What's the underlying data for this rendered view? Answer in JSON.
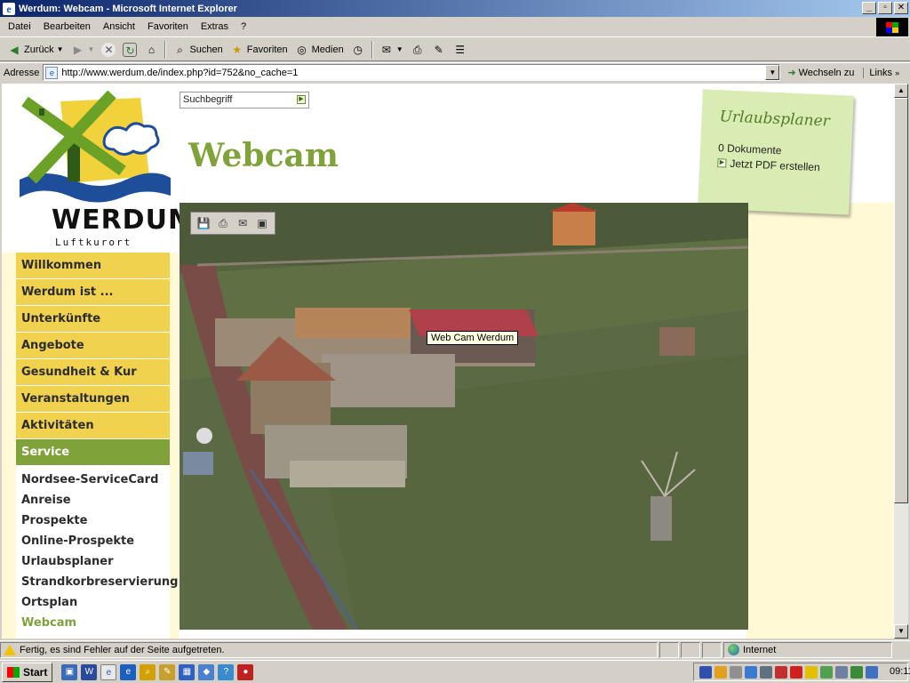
{
  "window": {
    "title": "Werdum: Webcam - Microsoft Internet Explorer",
    "buttons": [
      "_",
      "▫",
      "✕"
    ]
  },
  "menu": [
    "Datei",
    "Bearbeiten",
    "Ansicht",
    "Favoriten",
    "Extras",
    "?"
  ],
  "toolbar": {
    "back": "Zurück",
    "search": "Suchen",
    "favorites": "Favoriten",
    "media": "Medien"
  },
  "address": {
    "label": "Adresse",
    "url": "http://www.werdum.de/index.php?id=752&no_cache=1",
    "go": "Wechseln zu",
    "links": "Links"
  },
  "page": {
    "logo": {
      "name": "WERDUM",
      "sub": "Luftkurort"
    },
    "search_placeholder": "Suchbegriff",
    "title": "Webcam",
    "planner": {
      "title": "Urlaubsplaner",
      "docs": "0 Dokumente",
      "pdf": "Jetzt PDF erstellen"
    },
    "nav": [
      {
        "label": "Willkommen",
        "active": false
      },
      {
        "label": "Werdum ist ...",
        "active": false
      },
      {
        "label": "Unterkünfte",
        "active": false
      },
      {
        "label": "Angebote",
        "active": false
      },
      {
        "label": "Gesundheit & Kur",
        "active": false
      },
      {
        "label": "Veranstaltungen",
        "active": false
      },
      {
        "label": "Aktivitäten",
        "active": false
      },
      {
        "label": "Service",
        "active": true
      }
    ],
    "subnav": [
      {
        "label": "Nordsee-ServiceCard",
        "current": false
      },
      {
        "label": "Anreise",
        "current": false
      },
      {
        "label": "Prospekte",
        "current": false
      },
      {
        "label": "Online-Prospekte",
        "current": false
      },
      {
        "label": "Urlaubsplaner",
        "current": false
      },
      {
        "label": "Strandkorbreservierung",
        "current": false
      },
      {
        "label": "Ortsplan",
        "current": false
      },
      {
        "label": "Webcam",
        "current": true
      }
    ],
    "image_tooltip": "Web Cam Werdum"
  },
  "status": {
    "message": "Fertig, es sind Fehler auf der Seite aufgetreten.",
    "zone": "Internet"
  },
  "taskbar": {
    "start": "Start",
    "clock": "09:11"
  },
  "colors": {
    "brand_green": "#7fa23a",
    "nav_yellow": "#f1d24e",
    "planner_bg": "#d9ecb3"
  }
}
